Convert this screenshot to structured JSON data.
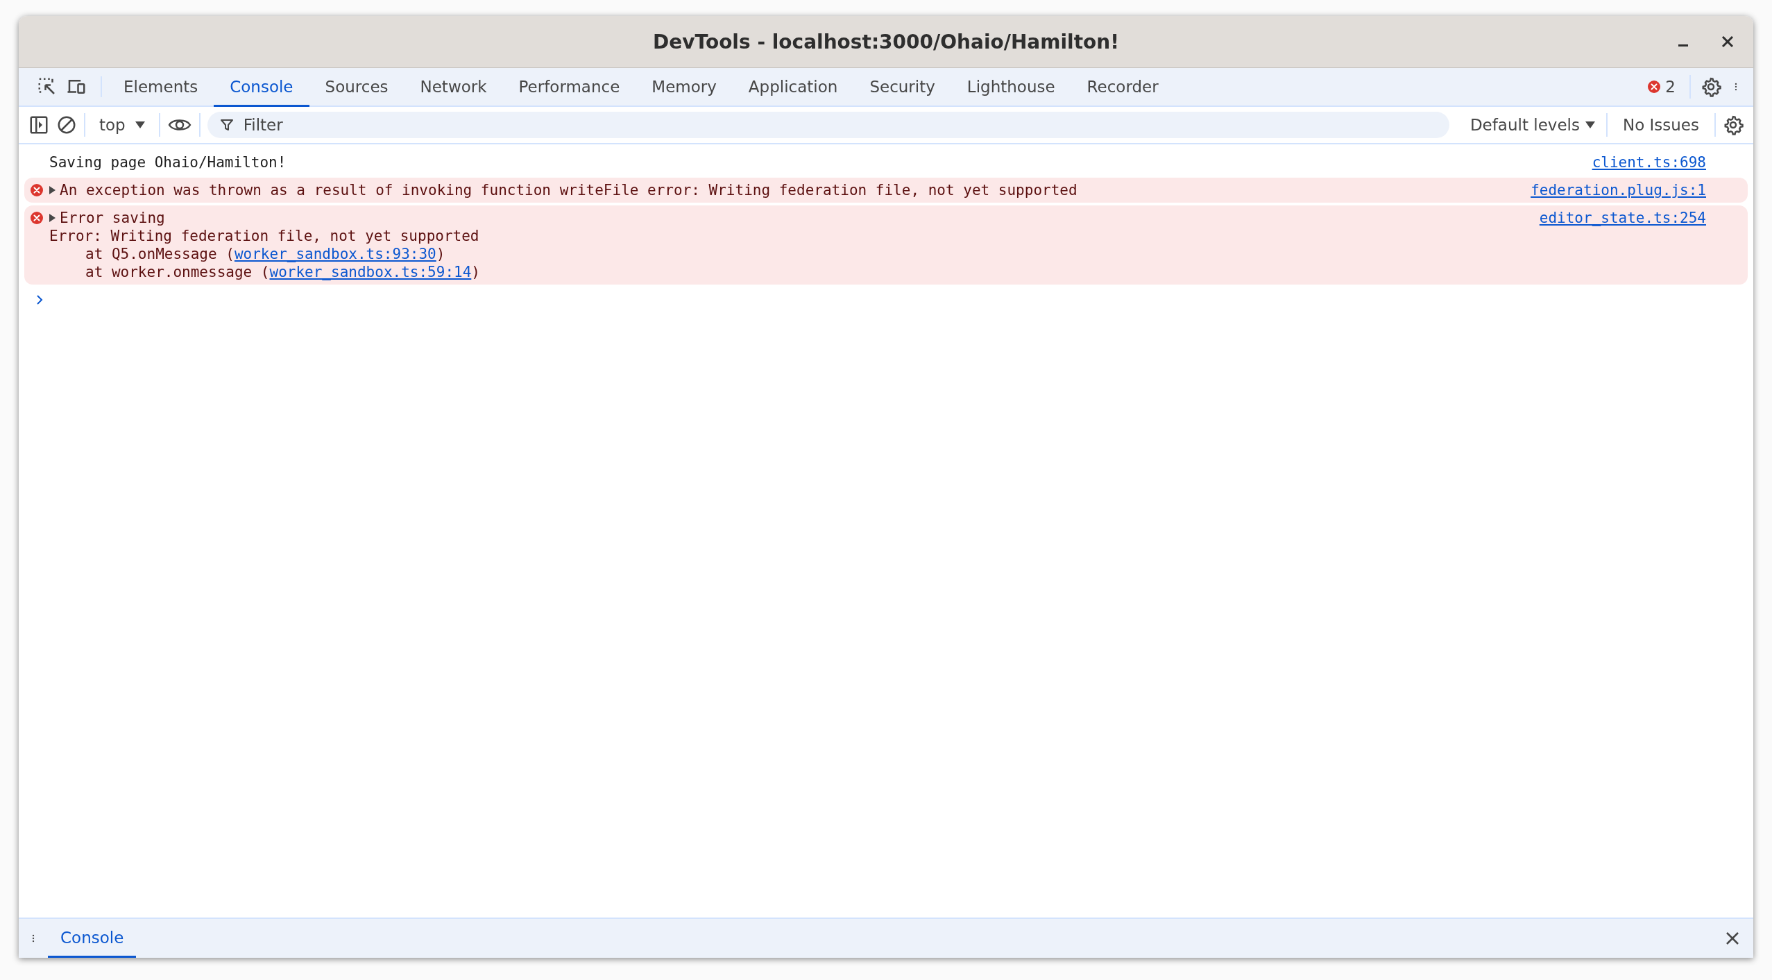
{
  "window": {
    "title": "DevTools - localhost:3000/Ohaio/Hamilton!"
  },
  "tabs": [
    {
      "label": "Elements",
      "selected": false
    },
    {
      "label": "Console",
      "selected": true
    },
    {
      "label": "Sources",
      "selected": false
    },
    {
      "label": "Network",
      "selected": false
    },
    {
      "label": "Performance",
      "selected": false
    },
    {
      "label": "Memory",
      "selected": false
    },
    {
      "label": "Application",
      "selected": false
    },
    {
      "label": "Security",
      "selected": false
    },
    {
      "label": "Lighthouse",
      "selected": false
    },
    {
      "label": "Recorder",
      "selected": false
    }
  ],
  "error_count": "2",
  "toolbar": {
    "context": "top",
    "filter": {
      "placeholder": "Filter"
    },
    "levels": "Default levels",
    "issues": "No Issues"
  },
  "messages": [
    {
      "kind": "log",
      "text": "Saving page Ohaio/Hamilton!",
      "source": "client.ts:698"
    },
    {
      "kind": "error",
      "expanded": false,
      "text": "An exception was thrown as a result of invoking function writeFile error: Writing federation file, not yet supported",
      "source": "federation.plug.js:1"
    },
    {
      "kind": "error",
      "expanded": false,
      "text": "Error saving",
      "source": "editor_state.ts:254",
      "detail": "Error: Writing federation file, not yet supported",
      "stack": [
        {
          "prefix": "at Q5.onMessage (",
          "link": "worker_sandbox.ts:93:30",
          "suffix": ")"
        },
        {
          "prefix": "at worker.onmessage (",
          "link": "worker_sandbox.ts:59:14",
          "suffix": ")"
        }
      ]
    }
  ],
  "drawer": {
    "tabs": [
      {
        "label": "Console",
        "selected": true
      }
    ]
  }
}
